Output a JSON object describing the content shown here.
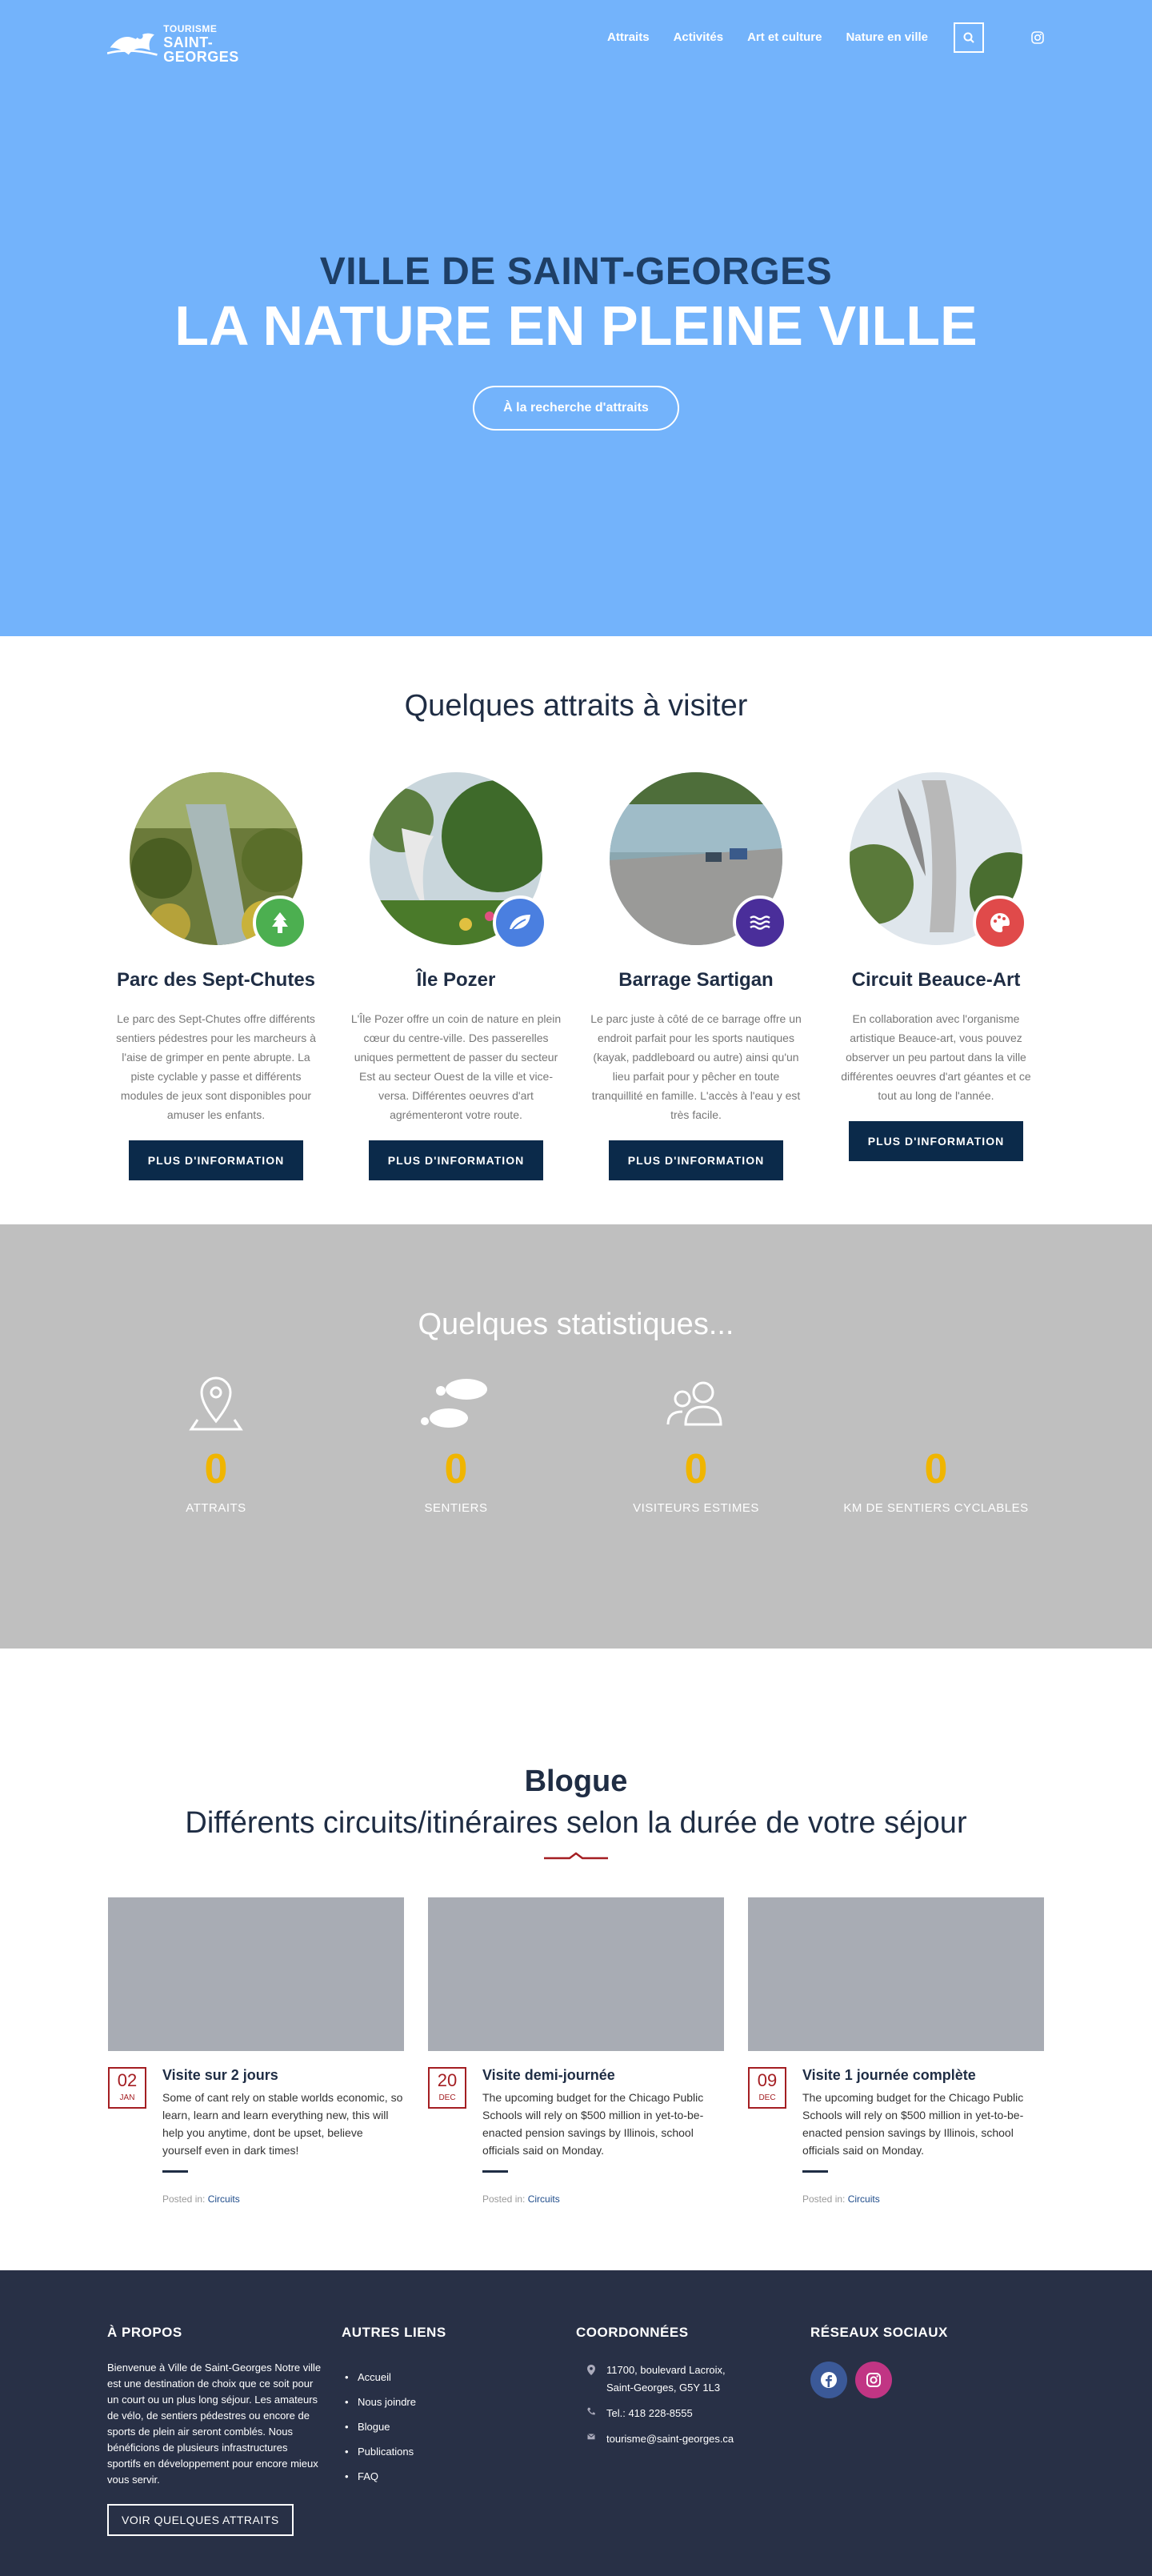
{
  "header": {
    "logo_line1": "TOURISME",
    "logo_line2": "SAINT-GEORGES",
    "nav": [
      "Attraits",
      "Activités",
      "Art et culture",
      "Nature en ville"
    ]
  },
  "hero": {
    "subtitle": "VILLE DE SAINT-GEORGES",
    "title": "LA NATURE EN PLEINE VILLE",
    "cta": "À la recherche d'attraits"
  },
  "attraits": {
    "heading": "Quelques attraits à visiter",
    "button_label": "PLUS D'INFORMATION",
    "items": [
      {
        "name": "Parc des Sept-Chutes",
        "desc": "Le parc des Sept-Chutes offre différents sentiers pédestres pour les marcheurs à l'aise de grimper en pente abrupte. La piste cyclable y passe et différents modules de jeux sont disponibles pour amuser les enfants.",
        "icon": "tree-icon",
        "color": "#4caf50"
      },
      {
        "name": "Île Pozer",
        "desc": "L'Île Pozer offre un coin de nature en plein cœur du centre-ville. Des passerelles uniques permettent de passer du secteur Est au secteur Ouest de la ville et vice-versa. Différentes oeuvres d'art agrémenteront votre route.",
        "icon": "leaf-icon",
        "color": "#4a7fe0"
      },
      {
        "name": "Barrage Sartigan",
        "desc": "Le parc juste à côté de ce barrage offre un endroit parfait pour les sports nautiques (kayak, paddleboard ou autre) ainsi qu'un lieu parfait pour y pêcher en toute tranquillité en famille. L'accès à l'eau y est très facile.",
        "icon": "water-icon",
        "color": "#4a2e9a"
      },
      {
        "name": "Circuit Beauce-Art",
        "desc": "En collaboration avec l'organisme artistique Beauce-art, vous pouvez observer un peu partout dans la ville différentes oeuvres d'art géantes et ce tout au long de l'année.",
        "icon": "palette-icon",
        "color": "#e04a4a"
      }
    ]
  },
  "stats": {
    "heading": "Quelques statistiques...",
    "items": [
      {
        "value": "0",
        "label": "ATTRAITS",
        "icon": "map-pin-icon"
      },
      {
        "value": "0",
        "label": "SENTIERS",
        "icon": "footprints-icon"
      },
      {
        "value": "0",
        "label": "VISITEURS ESTIMES",
        "icon": "users-icon"
      },
      {
        "value": "0",
        "label": "KM DE SENTIERS CYCLABLES",
        "icon": "bike-trail-icon"
      }
    ]
  },
  "blog": {
    "title": "Blogue",
    "subtitle": "Différents circuits/itinéraires selon la durée de votre séjour",
    "posted_in": "Posted in:",
    "posts": [
      {
        "day": "02",
        "month": "JAN",
        "title": "Visite sur 2 jours",
        "excerpt": "Some of cant rely on stable worlds economic, so learn, learn and learn everything new, this will help you anytime, dont be upset, believe yourself even in dark times!",
        "category": "Circuits"
      },
      {
        "day": "20",
        "month": "DEC",
        "title": "Visite demi-journée",
        "excerpt": "The upcoming budget for the Chicago Public Schools will rely on $500 million in yet-to-be-enacted pension savings by Illinois, school officials said on Monday.",
        "category": "Circuits"
      },
      {
        "day": "09",
        "month": "DEC",
        "title": "Visite 1 journée complète",
        "excerpt": "The upcoming budget for the Chicago Public Schools will rely on $500 million in yet-to-be-enacted pension savings by Illinois, school officials said on Monday.",
        "category": "Circuits"
      }
    ]
  },
  "footer": {
    "about_heading": "À PROPOS",
    "about_text": "Bienvenue à Ville de Saint-Georges Notre ville est une destination de choix que ce soit pour un court ou un plus long séjour. Les amateurs de vélo, de sentiers pédestres ou encore de sports de plein air seront comblés. Nous bénéficions de plusieurs infrastructures sportifs en développement pour encore mieux vous servir.",
    "about_button": "VOIR QUELQUES ATTRAITS",
    "links_heading": "AUTRES LIENS",
    "links": [
      "Accueil",
      "Nous joindre",
      "Blogue",
      "Publications",
      "FAQ"
    ],
    "contact_heading": "COORDONNÉES",
    "address": "11700, boulevard Lacroix, Saint-Georges, G5Y 1L3",
    "phone": "Tel.: 418 228-8555",
    "email": "tourisme@saint-georges.ca",
    "social_heading": "RÉSEAUX SOCIAUX"
  },
  "colors": {
    "hero_bg": "#73b3fb",
    "navy": "#0b2a4a",
    "stats_bg": "#bfbfbf",
    "stat_number": "#f0b500",
    "footer_bg": "#283046",
    "date_red": "#a41e22",
    "facebook": "#3b5998",
    "instagram": "#c13584"
  }
}
